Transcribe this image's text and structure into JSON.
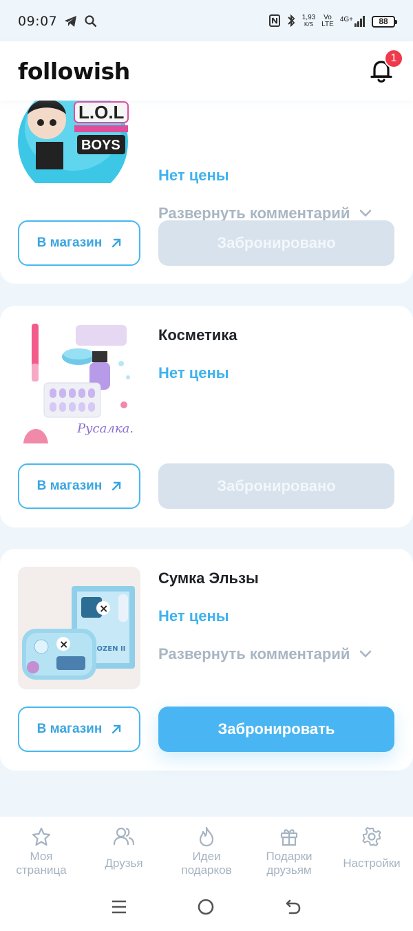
{
  "status": {
    "time": "09:07",
    "net_speed": "1,93",
    "net_unit": "K/S",
    "volte_top": "Vo",
    "volte_bottom": "LTE",
    "signal": "4G+",
    "battery": "88"
  },
  "header": {
    "logo": "followish",
    "notifications_count": "1"
  },
  "cards": [
    {
      "title": "",
      "price": "Нет цены",
      "expand_label": "Развернуть комментарий",
      "shop_label": "В магазин",
      "reserve_label": "Забронировано",
      "reserved": true
    },
    {
      "title": "Косметика",
      "price": "Нет цены",
      "shop_label": "В магазин",
      "reserve_label": "Забронировано",
      "reserved": true
    },
    {
      "title": "Сумка Эльзы",
      "price": "Нет цены",
      "expand_label": "Развернуть комментарий",
      "shop_label": "В магазин",
      "reserve_label": "Забронировать",
      "reserved": false
    }
  ],
  "bottom_nav": [
    {
      "line1": "Моя",
      "line2": "страница",
      "icon": "star-icon"
    },
    {
      "label": "Друзья",
      "icon": "friends-icon"
    },
    {
      "line1": "Идеи",
      "line2": "подарков",
      "icon": "flame-icon"
    },
    {
      "line1": "Подарки",
      "line2": "друзьям",
      "icon": "gift-icon"
    },
    {
      "label": "Настройки",
      "icon": "gear-icon"
    }
  ],
  "colors": {
    "accent": "#49b6f3",
    "price": "#3fb3ee",
    "badge": "#f0394a",
    "muted": "#a9b6c3",
    "reserved_bg": "#d7e2ec"
  }
}
